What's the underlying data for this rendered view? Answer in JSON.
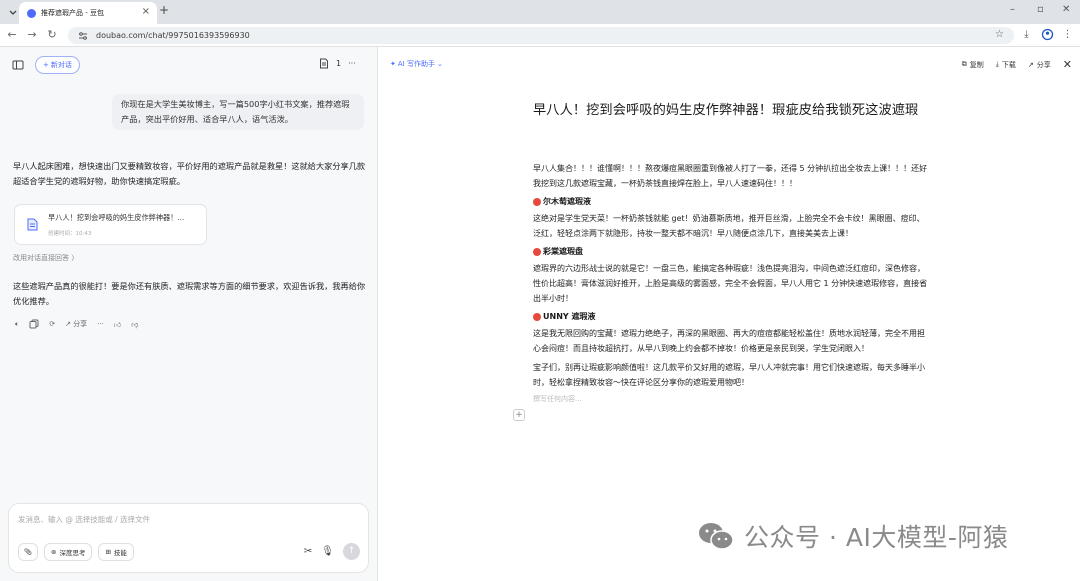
{
  "browser": {
    "tab_title": "推荐遮瑕产品 - 豆包",
    "url": "doubao.com/chat/9975016393596930"
  },
  "left": {
    "new_chat": "新对话",
    "doc_count": "1",
    "user_message": "你现在是大学生美妆博主，写一篇500字小红书文案，推荐遮瑕产品，突出平价好用、适合早八人，语气活泼。",
    "bot_intro": "早八人起床困难，想快速出门又要精致妆容，平价好用的遮瑕产品就是救星！这就给大家分享几款超适合学生党的遮瑕好物，助你快速搞定瑕疵。",
    "card": {
      "title": "早八人！挖到会呼吸的妈生皮作弊神器！...",
      "subtitle": "创建时间：10:43"
    },
    "edit_link": "改用对话直接回答 〉",
    "bot_outro": "这些遮瑕产品真的很能打！要是你还有肤质、遮瑕需求等方面的细节要求，欢迎告诉我，我再给你优化推荐。",
    "actions": {
      "share": "分享",
      "more": "···"
    },
    "input": {
      "placeholder": "发消息、输入 @ 选择技能或 / 选择文件",
      "deep_think": "深度思考",
      "skills": "技能"
    }
  },
  "right": {
    "ai_writing": "AI 写作助手",
    "copy": "复制",
    "download": "下载",
    "share": "分享",
    "doc": {
      "title": "早八人！挖到会呼吸的妈生皮作弊神器！瑕疵皮给我锁死这波遮瑕",
      "p1": "早八人集合！！！谁懂啊！！！熬夜爆痘黑眼圈重到像被人打了一拳，还得 5 分钟扒拉出全妆去上课！！！还好我挖到这几款遮瑕宝藏，一杯奶茶钱直接焊在脸上，早八人速速码住！！！",
      "h1": "尔木萄遮瑕液",
      "p2": "这绝对是学生党天菜！一杯奶茶钱就能 get！奶油慕斯质地，推开巨丝滑，上脸完全不会卡纹！黑眼圈、痘印、泛红，轻轻点涂两下就隐形，持妆一整天都不暗沉！早八随便点涂几下，直接美美去上课！",
      "h2": "彩棠遮瑕盘",
      "p3": "遮瑕界的六边形战士说的就是它！一盘三色，能搞定各种瑕疵！浅色提亮泪沟，中间色遮泛红痘印，深色修容，性价比超高！膏体滋润好推开，上脸是高级的雾面感，完全不会假面，早八人用它 1 分钟快速遮瑕修容，直接省出半小时！",
      "h3": "UNNY 遮瑕液",
      "p4": "这是我无限回购的宝藏！遮瑕力绝绝子，再深的黑眼圈、再大的痘痘都能轻松盖住！质地水润轻薄，完全不用担心会闷痘！而且持妆超抗打，从早八到晚上约会都不掉妆！价格更是亲民到哭，学生党闭眼入！",
      "p5": "宝子们，别再让瑕疵影响颜值啦！这几款平价又好用的遮瑕，早八人冲就完事！用它们快速遮瑕，每天多睡半小时，轻松拿捏精致妆容～快在评论区分享你的遮瑕爱用物吧！",
      "placeholder": "撰写任何内容..."
    }
  },
  "watermark": "公众号 · AI大模型-阿猿"
}
